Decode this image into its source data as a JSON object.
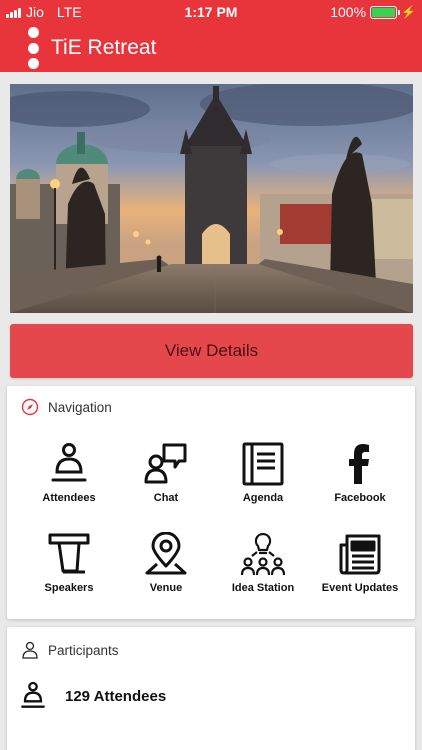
{
  "status_bar": {
    "carrier": "Jio",
    "network": "LTE",
    "time": "1:17 PM",
    "battery": "100%",
    "battery_level": 1.0
  },
  "app_bar": {
    "title": "TiE Retreat",
    "menu_icon": "vertical-dots-icon"
  },
  "hero": {
    "image": "charles-bridge-prague-photo"
  },
  "view_details": {
    "label": "View Details"
  },
  "navigation": {
    "title": "Navigation",
    "icon": "compass-icon",
    "items": [
      {
        "label": "Attendees",
        "icon": "attendee-icon"
      },
      {
        "label": "Chat",
        "icon": "chat-icon"
      },
      {
        "label": "Agenda",
        "icon": "agenda-book-icon"
      },
      {
        "label": "Facebook",
        "icon": "facebook-icon"
      },
      {
        "label": "Speakers",
        "icon": "podium-icon"
      },
      {
        "label": "Venue",
        "icon": "map-pin-icon"
      },
      {
        "label": "Idea Station",
        "icon": "idea-group-icon"
      },
      {
        "label": "Event Updates",
        "icon": "newspaper-icon"
      }
    ]
  },
  "participants": {
    "title": "Participants",
    "icon": "person-icon",
    "attendees_label": "129 Attendees",
    "attendees_icon": "attendee-icon"
  },
  "colors": {
    "brand_red": "#e8343b",
    "button_red": "#e5484c",
    "battery_green": "#39d353"
  }
}
